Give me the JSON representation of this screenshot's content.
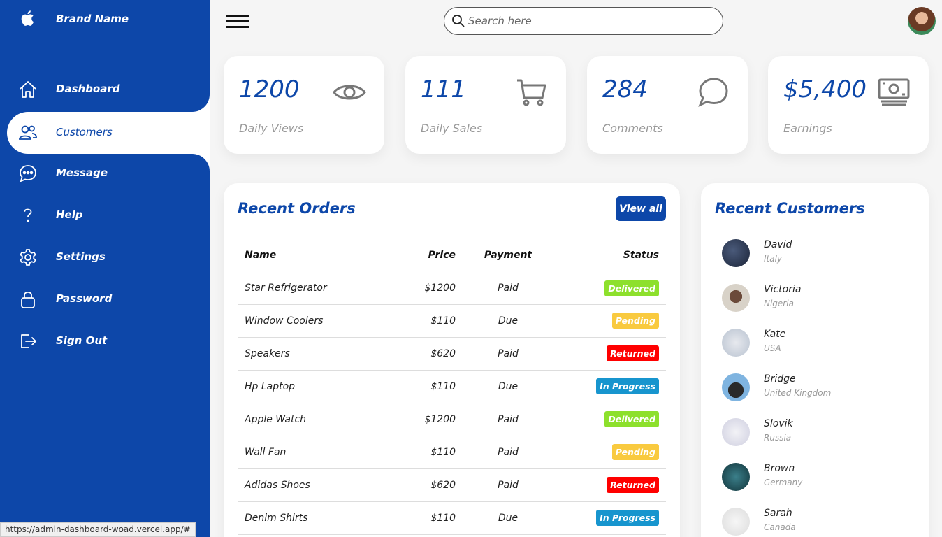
{
  "brand": {
    "name": "Brand Name",
    "icon": "apple-icon"
  },
  "sidebar": {
    "items": [
      {
        "label": "Dashboard",
        "icon": "home-icon"
      },
      {
        "label": "Customers",
        "icon": "people-icon",
        "active": true
      },
      {
        "label": "Message",
        "icon": "chat-icon"
      },
      {
        "label": "Help",
        "icon": "help-icon"
      },
      {
        "label": "Settings",
        "icon": "gear-icon"
      },
      {
        "label": "Password",
        "icon": "lock-icon"
      },
      {
        "label": "Sign Out",
        "icon": "logout-icon"
      }
    ]
  },
  "search": {
    "placeholder": "Search here"
  },
  "cards": [
    {
      "value": "1200",
      "caption": "Daily Views",
      "icon": "eye-icon"
    },
    {
      "value": "111",
      "caption": "Daily Sales",
      "icon": "cart-icon"
    },
    {
      "value": "284",
      "caption": "Comments",
      "icon": "comment-icon"
    },
    {
      "value": "$5,400",
      "caption": "Earnings",
      "icon": "cash-icon"
    }
  ],
  "orders": {
    "title": "Recent Orders",
    "view_all": "View all",
    "headers": {
      "name": "Name",
      "price": "Price",
      "payment": "Payment",
      "status": "Status"
    },
    "rows": [
      {
        "name": "Star Refrigerator",
        "price": "$1200",
        "payment": "Paid",
        "status": "Delivered"
      },
      {
        "name": "Window Coolers",
        "price": "$110",
        "payment": "Due",
        "status": "Pending"
      },
      {
        "name": "Speakers",
        "price": "$620",
        "payment": "Paid",
        "status": "Returned"
      },
      {
        "name": "Hp Laptop",
        "price": "$110",
        "payment": "Due",
        "status": "In Progress"
      },
      {
        "name": "Apple Watch",
        "price": "$1200",
        "payment": "Paid",
        "status": "Delivered"
      },
      {
        "name": "Wall Fan",
        "price": "$110",
        "payment": "Paid",
        "status": "Pending"
      },
      {
        "name": "Adidas Shoes",
        "price": "$620",
        "payment": "Paid",
        "status": "Returned"
      },
      {
        "name": "Denim Shirts",
        "price": "$110",
        "payment": "Due",
        "status": "In Progress"
      }
    ]
  },
  "status_colors": {
    "Delivered": "#8de02c",
    "Pending": "#f9ca3f",
    "Returned": "#f00",
    "In Progress": "#1795ce"
  },
  "customers": {
    "title": "Recent Customers",
    "items": [
      {
        "name": "David",
        "country": "Italy"
      },
      {
        "name": "Victoria",
        "country": "Nigeria"
      },
      {
        "name": "Kate",
        "country": "USA"
      },
      {
        "name": "Bridge",
        "country": "United Kingdom"
      },
      {
        "name": "Slovik",
        "country": "Russia"
      },
      {
        "name": "Brown",
        "country": "Germany"
      },
      {
        "name": "Sarah",
        "country": "Canada"
      }
    ]
  },
  "status_bar": {
    "url": "https://admin-dashboard-woad.vercel.app/#"
  }
}
